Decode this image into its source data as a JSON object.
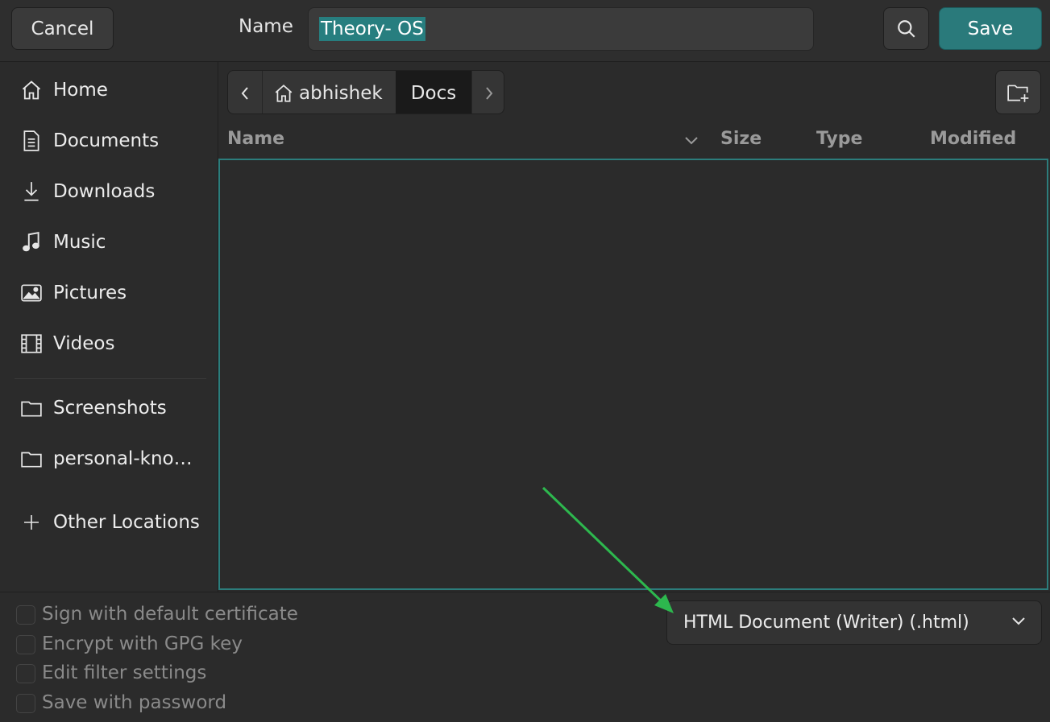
{
  "header": {
    "cancel_label": "Cancel",
    "name_label": "Name",
    "name_value": "Theory- OS",
    "save_label": "Save"
  },
  "sidebar": {
    "items": [
      {
        "label": "Home",
        "icon": "home-icon"
      },
      {
        "label": "Documents",
        "icon": "document-icon"
      },
      {
        "label": "Downloads",
        "icon": "download-icon"
      },
      {
        "label": "Music",
        "icon": "music-icon"
      },
      {
        "label": "Pictures",
        "icon": "picture-icon"
      },
      {
        "label": "Videos",
        "icon": "video-icon"
      },
      {
        "label": "Screenshots",
        "icon": "folder-icon"
      },
      {
        "label": "personal-kno…",
        "icon": "folder-icon"
      },
      {
        "label": "Other Locations",
        "icon": "plus-icon"
      }
    ]
  },
  "breadcrumb": {
    "home": "abhishek",
    "current": "Docs"
  },
  "columns": {
    "name": "Name",
    "size": "Size",
    "type": "Type",
    "modified": "Modified"
  },
  "options": [
    {
      "label": "Sign with default certificate",
      "checked": false
    },
    {
      "label": "Encrypt with GPG key",
      "checked": false
    },
    {
      "label": "Edit filter settings",
      "checked": false
    },
    {
      "label": "Save with password",
      "checked": false
    }
  ],
  "file_type": {
    "selected": "HTML Document (Writer) (.html)"
  },
  "colors": {
    "accent": "#2a7a7b",
    "selection": "#277e7f",
    "annotation_arrow": "#2db84e"
  }
}
